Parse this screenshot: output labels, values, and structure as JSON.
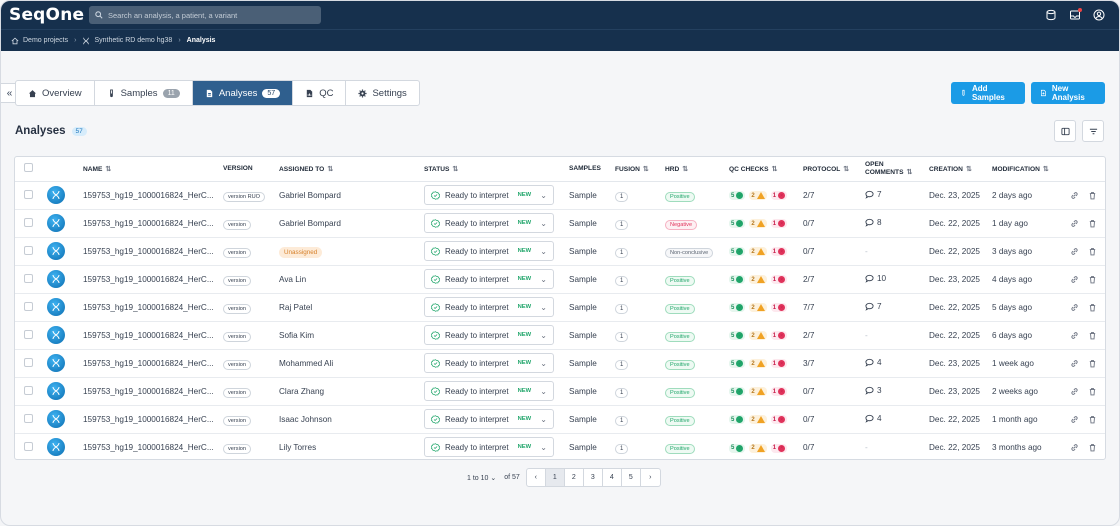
{
  "app": {
    "logo": "SeqOne"
  },
  "search": {
    "placeholder": "Search an analysis, a patient, a variant"
  },
  "breadcrumb": {
    "items": [
      "Demo projects",
      "Synthetic RD demo hg38"
    ],
    "current": "Analysis"
  },
  "tabs": [
    {
      "label": "Overview"
    },
    {
      "label": "Samples",
      "count": "11"
    },
    {
      "label": "Analyses",
      "count": "57",
      "active": true
    },
    {
      "label": "QC"
    },
    {
      "label": "Settings"
    }
  ],
  "buttons": {
    "add_samples": "Add Samples",
    "new_analysis": "New Analysis"
  },
  "section": {
    "title": "Analyses",
    "count": "57"
  },
  "columns": {
    "name": "NAME",
    "version": "VERSION",
    "assigned_to": "ASSIGNED TO",
    "status": "STATUS",
    "samples": "SAMPLES",
    "fusion": "FUSION",
    "hrd": "HRD",
    "qc_checks": "QC CHECKS",
    "protocol": "PROTOCOL",
    "open_comments": "OPEN COMMENTS",
    "creation": "CREATION",
    "modification": "MODIFICATION"
  },
  "rows": [
    {
      "name": "159753_hg19_1000016824_HerC...",
      "version": "version RUO",
      "assigned": "Gabriel Bompard",
      "status": "Ready to interpret",
      "new": "NEW",
      "samples": "Sample",
      "fusion": "1",
      "hrd": "Positive",
      "hrd_type": "pos",
      "qc_ok": "5",
      "qc_warn": "2",
      "qc_err": "1",
      "protocol": "2/7",
      "comments": "7",
      "creation": "Dec. 23, 2025",
      "modification": "2 days ago"
    },
    {
      "name": "159753_hg19_1000016824_HerC...",
      "version": "version",
      "assigned": "Gabriel Bompard",
      "status": "Ready to interpret",
      "new": "NEW",
      "samples": "Sample",
      "fusion": "1",
      "hrd": "Negative",
      "hrd_type": "neg",
      "qc_ok": "5",
      "qc_warn": "2",
      "qc_err": "1",
      "protocol": "0/7",
      "comments": "8",
      "creation": "Dec. 22, 2025",
      "modification": "1 day ago"
    },
    {
      "name": "159753_hg19_1000016824_HerC...",
      "version": "version",
      "assigned": "Unassigned",
      "unassigned": true,
      "status": "Ready to interpret",
      "new": "NEW",
      "samples": "Sample",
      "fusion": "1",
      "hrd": "Non-conclusive",
      "hrd_type": "nc",
      "qc_ok": "5",
      "qc_warn": "2",
      "qc_err": "1",
      "protocol": "0/7",
      "comments": "-",
      "creation": "Dec. 22, 2025",
      "modification": "3 days ago"
    },
    {
      "name": "159753_hg19_1000016824_HerC...",
      "version": "version",
      "assigned": "Ava Lin",
      "status": "Ready to interpret",
      "new": "NEW",
      "samples": "Sample",
      "fusion": "1",
      "hrd": "Positive",
      "hrd_type": "pos",
      "qc_ok": "5",
      "qc_warn": "2",
      "qc_err": "1",
      "protocol": "2/7",
      "comments": "10",
      "creation": "Dec. 23, 2025",
      "modification": "4 days ago"
    },
    {
      "name": "159753_hg19_1000016824_HerC...",
      "version": "version",
      "assigned": "Raj Patel",
      "status": "Ready to interpret",
      "new": "NEW",
      "samples": "Sample",
      "fusion": "1",
      "hrd": "Positive",
      "hrd_type": "pos",
      "qc_ok": "5",
      "qc_warn": "2",
      "qc_err": "1",
      "protocol": "7/7",
      "comments": "7",
      "creation": "Dec. 22, 2025",
      "modification": "5 days ago"
    },
    {
      "name": "159753_hg19_1000016824_HerC...",
      "version": "version",
      "assigned": "Sofia Kim",
      "status": "Ready to interpret",
      "new": "NEW",
      "samples": "Sample",
      "fusion": "1",
      "hrd": "Positive",
      "hrd_type": "pos",
      "qc_ok": "5",
      "qc_warn": "2",
      "qc_err": "1",
      "protocol": "2/7",
      "comments": "-",
      "creation": "Dec. 22, 2025",
      "modification": "6 days ago"
    },
    {
      "name": "159753_hg19_1000016824_HerC...",
      "version": "version",
      "assigned": "Mohammed Ali",
      "status": "Ready to interpret",
      "new": "NEW",
      "samples": "Sample",
      "fusion": "1",
      "hrd": "Positive",
      "hrd_type": "pos",
      "qc_ok": "5",
      "qc_warn": "2",
      "qc_err": "1",
      "protocol": "3/7",
      "comments": "4",
      "creation": "Dec. 23, 2025",
      "modification": "1 week ago"
    },
    {
      "name": "159753_hg19_1000016824_HerC...",
      "version": "version",
      "assigned": "Clara Zhang",
      "status": "Ready to interpret",
      "new": "NEW",
      "samples": "Sample",
      "fusion": "1",
      "hrd": "Positive",
      "hrd_type": "pos",
      "qc_ok": "5",
      "qc_warn": "2",
      "qc_err": "1",
      "protocol": "0/7",
      "comments": "3",
      "creation": "Dec. 23, 2025",
      "modification": "2 weeks ago"
    },
    {
      "name": "159753_hg19_1000016824_HerC...",
      "version": "version",
      "assigned": "Isaac Johnson",
      "status": "Ready to interpret",
      "new": "NEW",
      "samples": "Sample",
      "fusion": "1",
      "hrd": "Positive",
      "hrd_type": "pos",
      "qc_ok": "5",
      "qc_warn": "2",
      "qc_err": "1",
      "protocol": "0/7",
      "comments": "4",
      "creation": "Dec. 22, 2025",
      "modification": "1 month ago"
    },
    {
      "name": "159753_hg19_1000016824_HerC...",
      "version": "version",
      "assigned": "Lily Torres",
      "status": "Ready to interpret",
      "new": "NEW",
      "samples": "Sample",
      "fusion": "1",
      "hrd": "Positive",
      "hrd_type": "pos",
      "qc_ok": "5",
      "qc_warn": "2",
      "qc_err": "1",
      "protocol": "0/7",
      "comments": "-",
      "creation": "Dec. 22, 2025",
      "modification": "3 months ago"
    }
  ],
  "pagination": {
    "range": "1 to 10",
    "of": "of 57",
    "pages": [
      "1",
      "2",
      "3",
      "4",
      "5"
    ],
    "current": "1"
  },
  "colors": {
    "navbar": "#16304d",
    "accent": "#1b9be6",
    "active_tab": "#2f5f8e"
  },
  "icons": [
    "search-icon",
    "database-icon",
    "inbox-icon",
    "user-icon",
    "home-icon",
    "tube-icon",
    "file-icon",
    "gear-icon",
    "link-icon",
    "trash-icon",
    "filter-icon",
    "columns-icon",
    "comment-icon"
  ]
}
